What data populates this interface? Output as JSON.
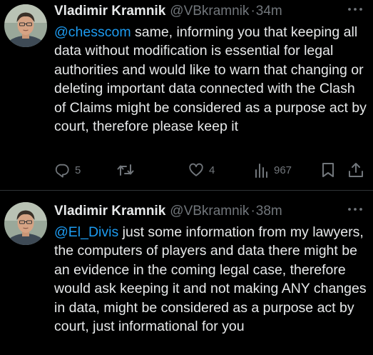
{
  "colors": {
    "background": "#000000",
    "text": "#e7e9ea",
    "secondary": "#71767b",
    "mention": "#1d9bf0",
    "divider": "#2f3336"
  },
  "tweets": [
    {
      "display_name": "Vladimir Kramnik",
      "handle": "@VBkramnik",
      "separator": "·",
      "time": "34m",
      "mention": "@chesscom",
      "text": " same, informing you that keeping all data without modification is essential for legal authorities and would like to warn that changing or deleting important data connected with the Clash of Claims might be considered as a purpose act by court, therefore please keep it",
      "actions": {
        "reply_count": "5",
        "retweet_count": "",
        "like_count": "4",
        "view_count": "967"
      },
      "icons": [
        "avatar",
        "more-icon",
        "reply-icon",
        "retweet-icon",
        "like-icon",
        "views-icon",
        "bookmark-icon",
        "share-icon"
      ]
    },
    {
      "display_name": "Vladimir Kramnik",
      "handle": "@VBkramnik",
      "separator": "·",
      "time": "38m",
      "mention": "@El_Divis",
      "text": " just some information from my lawyers, the computers of players and data there might be an evidence in the coming legal case, therefore would ask keeping it and not making ANY changes in data, might be considered as a purpose act by court, just informational for you",
      "icons": [
        "avatar",
        "more-icon"
      ]
    }
  ]
}
